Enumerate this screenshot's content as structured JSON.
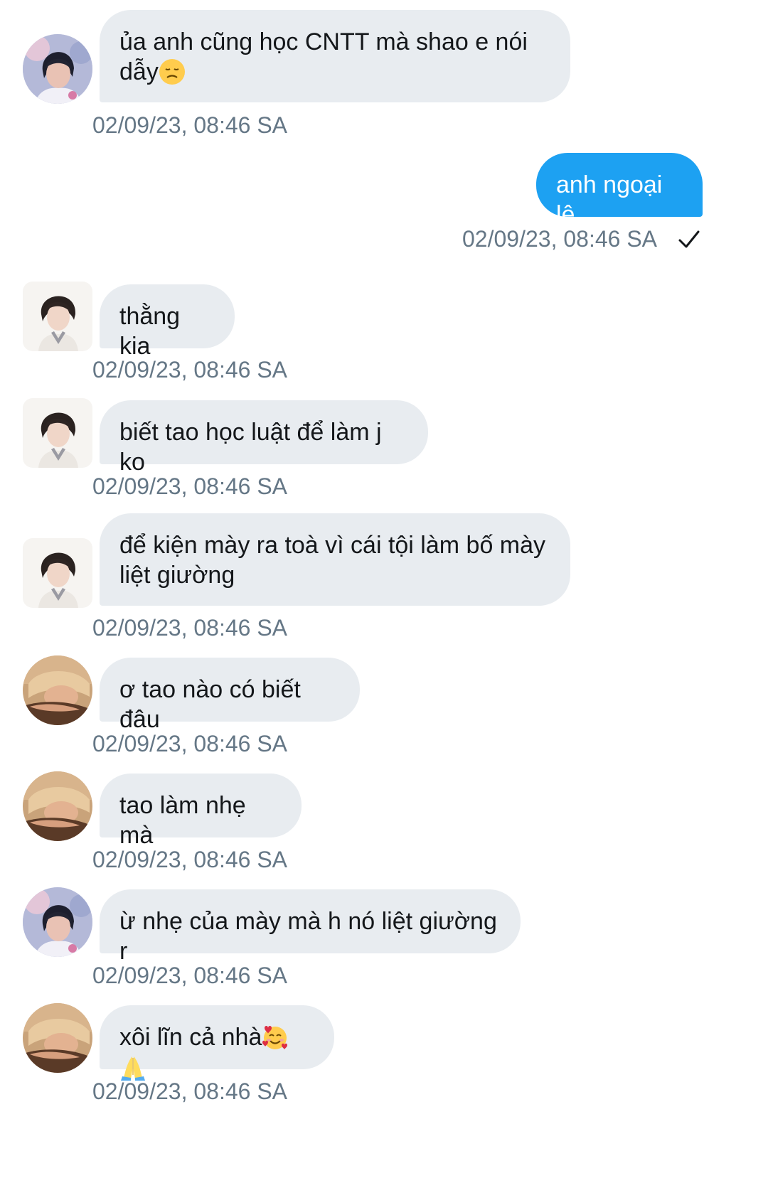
{
  "conversation": {
    "messages": [
      {
        "text": "ủa anh cũng học CNTT mà shao e nói\ndẫy",
        "emoji": [
          "disappointed-face"
        ],
        "time": "02/09/23, 08:46 SA",
        "direction": "incoming",
        "avatar": "avatar-concert"
      },
      {
        "text": "anh ngoại lệ",
        "time": "02/09/23, 08:46 SA",
        "direction": "outgoing",
        "status": "sent-checkmark"
      },
      {
        "text": "thằng kia",
        "time": "02/09/23, 08:46 SA",
        "direction": "incoming",
        "avatar": "avatar-studio"
      },
      {
        "text": "biết tao học luật để làm j ko",
        "time": "02/09/23, 08:46 SA",
        "direction": "incoming",
        "avatar": "avatar-studio"
      },
      {
        "text": "để kiện mày ra toà vì cái tội làm bố mày\nliệt giường",
        "time": "02/09/23, 08:46 SA",
        "direction": "incoming",
        "avatar": "avatar-studio"
      },
      {
        "text": "ơ tao nào có biết đâu",
        "time": "02/09/23, 08:46 SA",
        "direction": "incoming",
        "avatar": "avatar-sepia"
      },
      {
        "text": "tao làm nhẹ mà",
        "time": "02/09/23, 08:46 SA",
        "direction": "incoming",
        "avatar": "avatar-sepia"
      },
      {
        "text": "ừ nhẹ của mày mà h nó liệt giường r",
        "time": "02/09/23, 08:46 SA",
        "direction": "incoming",
        "avatar": "avatar-concert"
      },
      {
        "text": "xôi lĩn cả nhà",
        "emoji": [
          "smiling-face-with-hearts",
          "folded-hands"
        ],
        "time": "02/09/23, 08:46 SA",
        "direction": "incoming",
        "avatar": "avatar-sepia"
      }
    ]
  },
  "colors": {
    "incoming_bubble": "#e8ecf0",
    "outgoing_bubble": "#1da1f2",
    "timestamp": "#657786",
    "text": "#14171a"
  }
}
